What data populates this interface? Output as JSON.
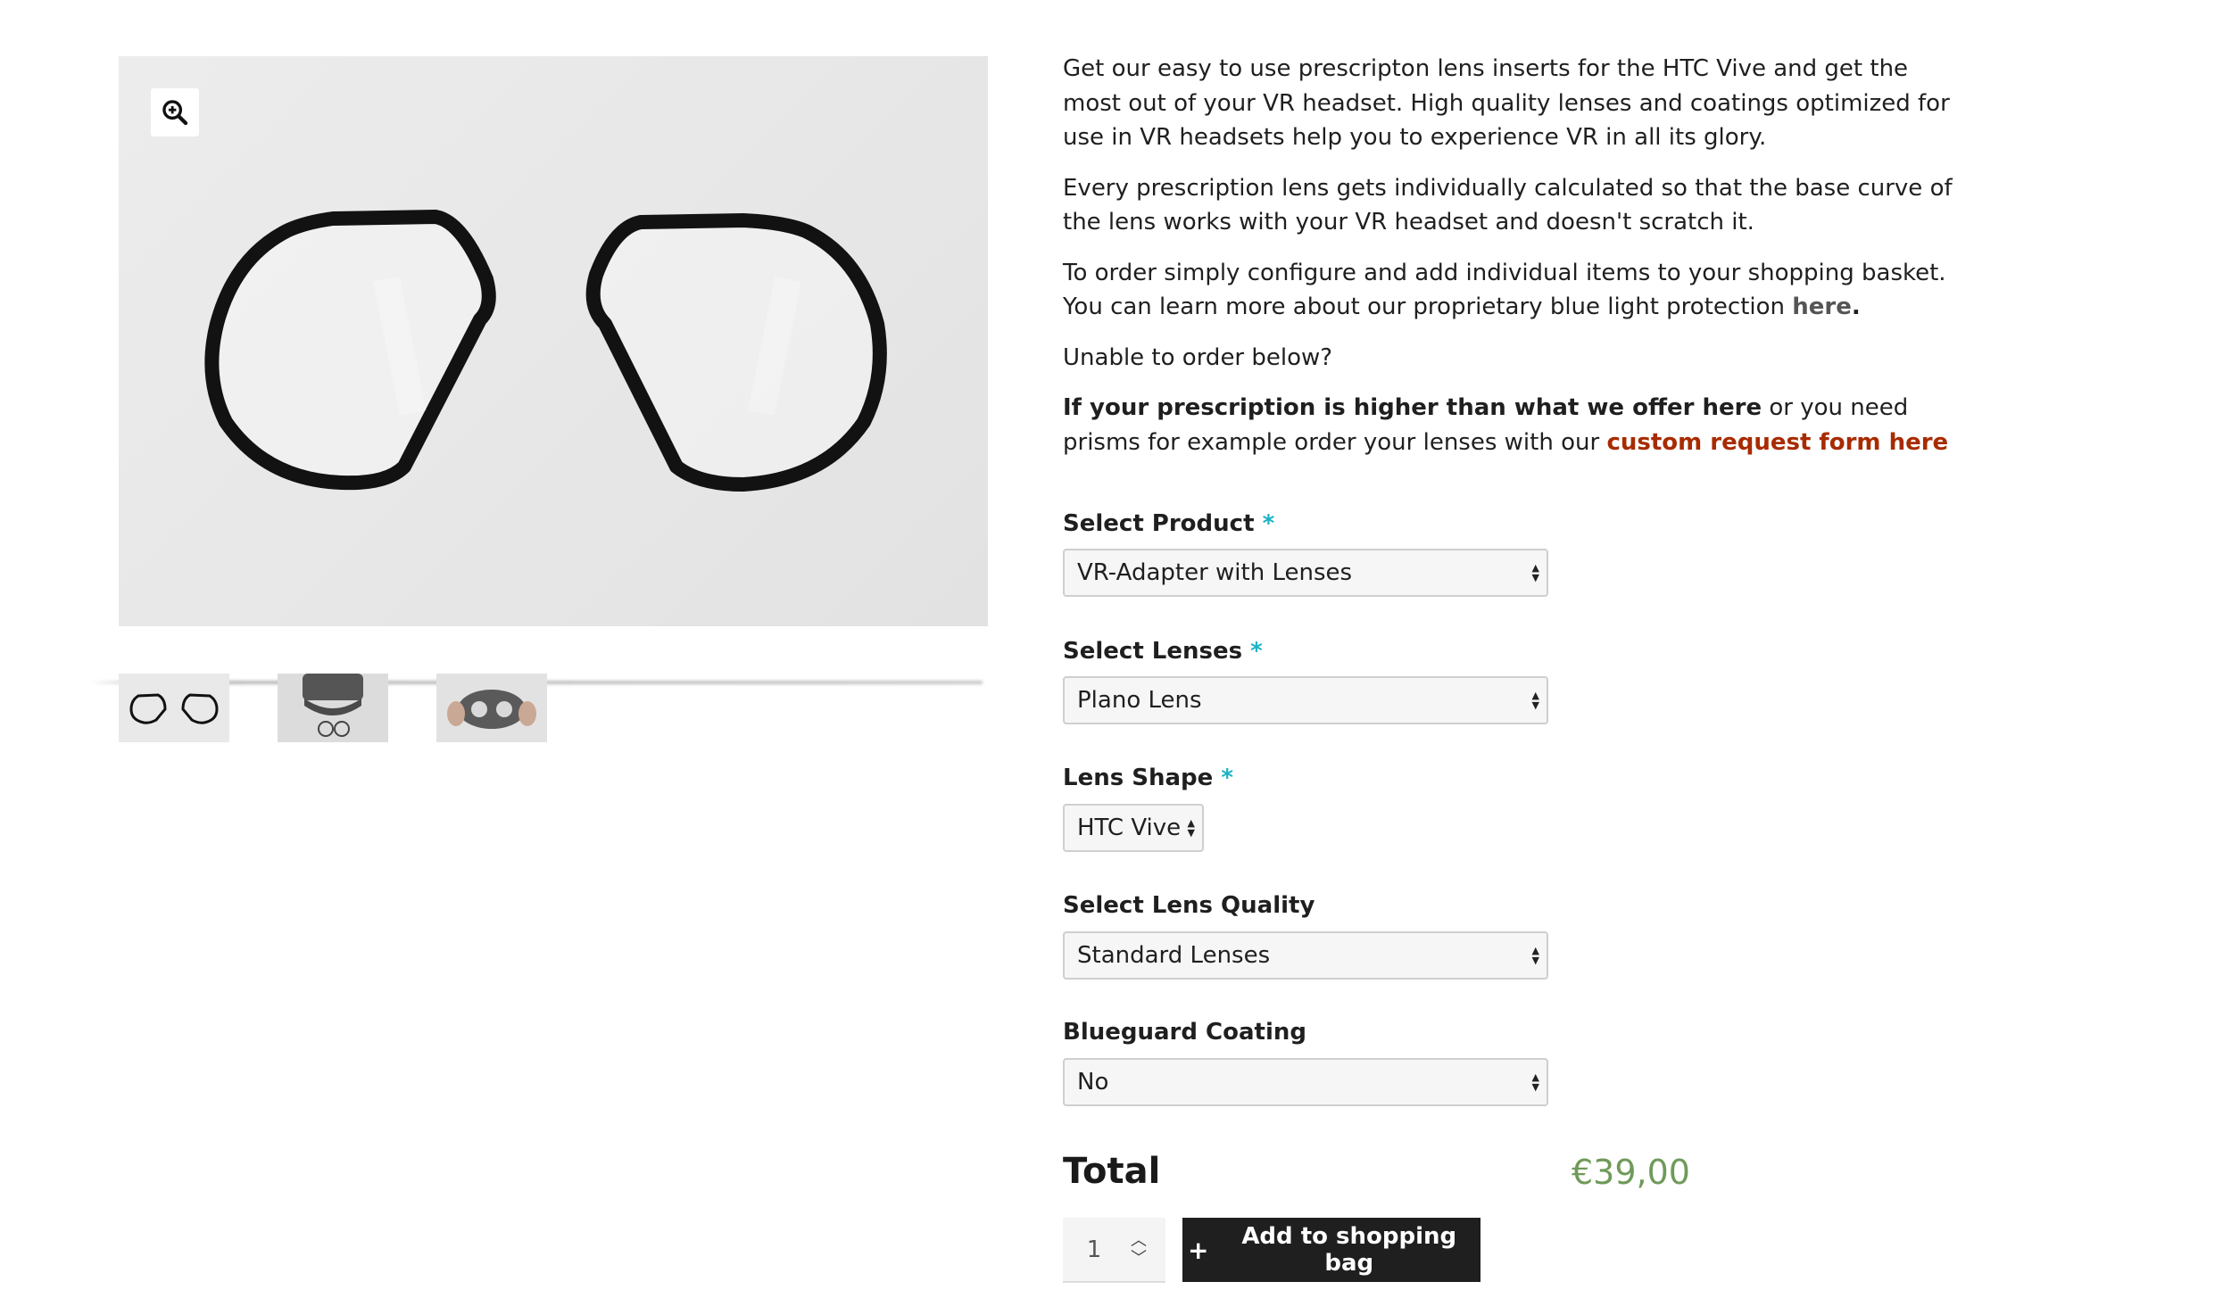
{
  "gallery": {
    "zoom_icon": "magnifier-plus-icon",
    "thumbnails": [
      {
        "name": "lens-inserts-thumb"
      },
      {
        "name": "headset-with-lenses-thumb"
      },
      {
        "name": "headset-in-hand-thumb"
      }
    ]
  },
  "description": {
    "p1": "Get our easy to use prescripton lens inserts for the HTC Vive and get the most out of your VR headset. High quality lenses and coatings optimized for use in VR headsets help you to experience VR in all its glory.",
    "p2": "Every prescription lens gets individually calculated so that the base curve of the lens works with your VR headset and doesn't scratch it.",
    "p3_text": "To order simply configure and add individual items to your shopping basket. You can learn more about our proprietary blue light protection ",
    "p3_link": "here",
    "p3_end": ".",
    "p4": "Unable to order below?",
    "p5_bold": "If your prescription is higher than what we offer here",
    "p5_text": " or you need prisms for example order your lenses with our ",
    "p5_link": "custom request form here"
  },
  "form": {
    "required_mark": "*",
    "product": {
      "label": "Select Product",
      "value": "VR-Adapter with Lenses"
    },
    "lenses": {
      "label": "Select Lenses",
      "value": "Plano Lens"
    },
    "shape": {
      "label": "Lens Shape",
      "value": "HTC Vive"
    },
    "quality": {
      "label": "Select Lens Quality",
      "value": "Standard Lenses"
    },
    "blueguard": {
      "label": "Blueguard Coating",
      "value": "No"
    }
  },
  "total": {
    "label": "Total",
    "price": "€39,00"
  },
  "cart": {
    "quantity": "1",
    "button_icon": "+",
    "button_label": "Add to shopping bag"
  },
  "colors": {
    "required": "#1ab3c6",
    "price": "#6f9a5a",
    "custom_link": "#a82b00",
    "button_bg": "#1f1f1f"
  }
}
